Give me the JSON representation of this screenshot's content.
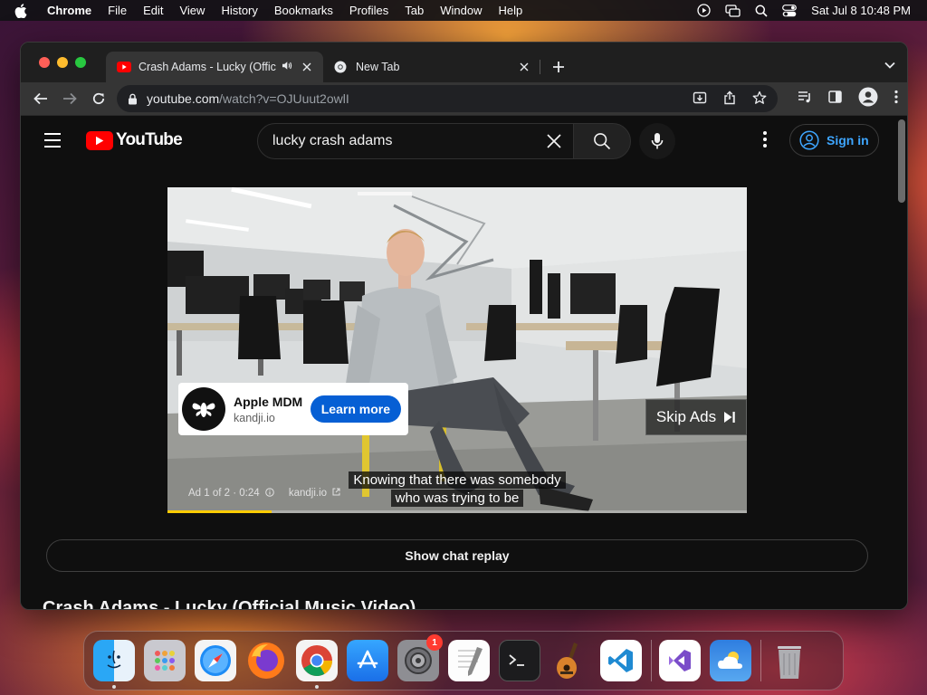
{
  "menubar": {
    "app_name": "Chrome",
    "items": [
      "File",
      "Edit",
      "View",
      "History",
      "Bookmarks",
      "Profiles",
      "Tab",
      "Window",
      "Help"
    ],
    "datetime": "Sat Jul 8  10:48 PM"
  },
  "browser": {
    "tabs": [
      {
        "title": "Crash Adams - Lucky (Offic",
        "favicon": "youtube-icon",
        "audio": true,
        "active": true
      },
      {
        "title": "New Tab",
        "favicon": "chrome-icon",
        "audio": false,
        "active": false
      }
    ],
    "url_host": "youtube.com",
    "url_path": "/watch?v=OJUuut2owlI"
  },
  "youtube": {
    "logo_text": "YouTube",
    "search_value": "lucky crash adams",
    "sign_in_label": "Sign in",
    "ad": {
      "advertiser": "Apple MDM",
      "domain": "kandji.io",
      "cta_label": "Learn more",
      "skip_label": "Skip Ads",
      "info_position": "Ad 1 of 2 · 0:24",
      "info_domain": "kandji.io",
      "progress_fraction": 0.18
    },
    "captions": [
      "Knowing that there was somebody",
      "who was trying to be"
    ],
    "chat_replay_label": "Show chat replay",
    "video_title": "Crash Adams - Lucky (Official Music Video)"
  },
  "dock": {
    "apps": [
      "Finder",
      "Launchpad",
      "Safari",
      "Firefox",
      "Chrome",
      "App Store",
      "System Settings",
      "TextEdit",
      "Terminal",
      "GarageBand",
      "Visual Studio Code",
      "Visual Studio",
      "Weather",
      "Trash"
    ],
    "settings_badge": "1"
  },
  "colors": {
    "youtube_red": "#ff0000",
    "link_blue": "#3ea6ff",
    "cta_blue": "#065fd4",
    "ad_progress": "#ffcc00"
  }
}
